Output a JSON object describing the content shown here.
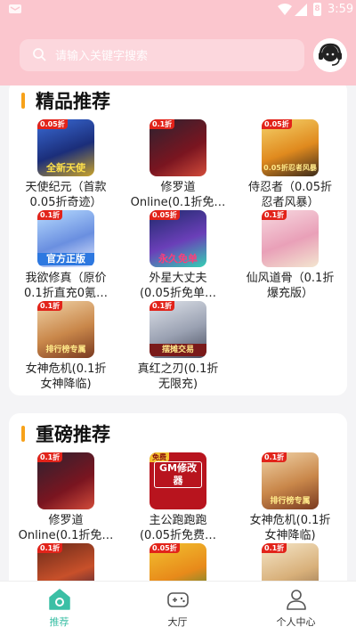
{
  "status_bar": {
    "time": "3:59",
    "battery": "8"
  },
  "search": {
    "placeholder": "请输入关键字搜索"
  },
  "colors": {
    "header_bg": "#fbc6ce",
    "accent": "#f7a21a",
    "active_tab": "#3bbfa5"
  },
  "sections": [
    {
      "title": "精品推荐",
      "games": [
        {
          "name": "天使纪元（首款\n0.05折奇迹）",
          "badge": "0.05折",
          "caption": "全新天使"
        },
        {
          "name": "修罗道\nOnline(0.1折免…",
          "badge": "0.1折",
          "caption": ""
        },
        {
          "name": "侍忍者（0.05折\n忍者风暴）",
          "badge": "0.05折",
          "caption": "0.05折忍者风暴"
        },
        {
          "name": "我欲修真（原价\n0.1折直充0氪…",
          "badge": "0.1折",
          "caption": "官方正版"
        },
        {
          "name": "外星大丈夫\n(0.05折免单…",
          "badge": "0.05折",
          "caption": "永久免单"
        },
        {
          "name": "仙风道骨（0.1折\n爆充版）",
          "badge": "0.1折",
          "caption": ""
        },
        {
          "name": "女神危机(0.1折\n女神降临)",
          "badge": "0.1折",
          "caption": "排行榜专属"
        },
        {
          "name": "真红之刃(0.1折\n无限充)",
          "badge": "0.1折",
          "caption": "摆摊交易"
        }
      ]
    },
    {
      "title": "重磅推荐",
      "games": [
        {
          "name": "修罗道\nOnline(0.1折免…",
          "badge": "0.1折",
          "caption": ""
        },
        {
          "name": "主公跑跑跑\n(0.05折免费…",
          "badge": "免费",
          "caption": "GM修改器"
        },
        {
          "name": "女神危机(0.1折\n女神降临)",
          "badge": "0.1折",
          "caption": "排行榜专属"
        },
        {
          "name": "",
          "badge": "0.1折",
          "caption": ""
        },
        {
          "name": "",
          "badge": "0.05折",
          "caption": ""
        },
        {
          "name": "",
          "badge": "0.1折",
          "caption": ""
        }
      ]
    }
  ],
  "tabs": [
    {
      "label": "推荐",
      "icon": "home-icon",
      "active": true
    },
    {
      "label": "大厅",
      "icon": "gamepad-icon",
      "active": false
    },
    {
      "label": "个人中心",
      "icon": "user-icon",
      "active": false
    }
  ]
}
